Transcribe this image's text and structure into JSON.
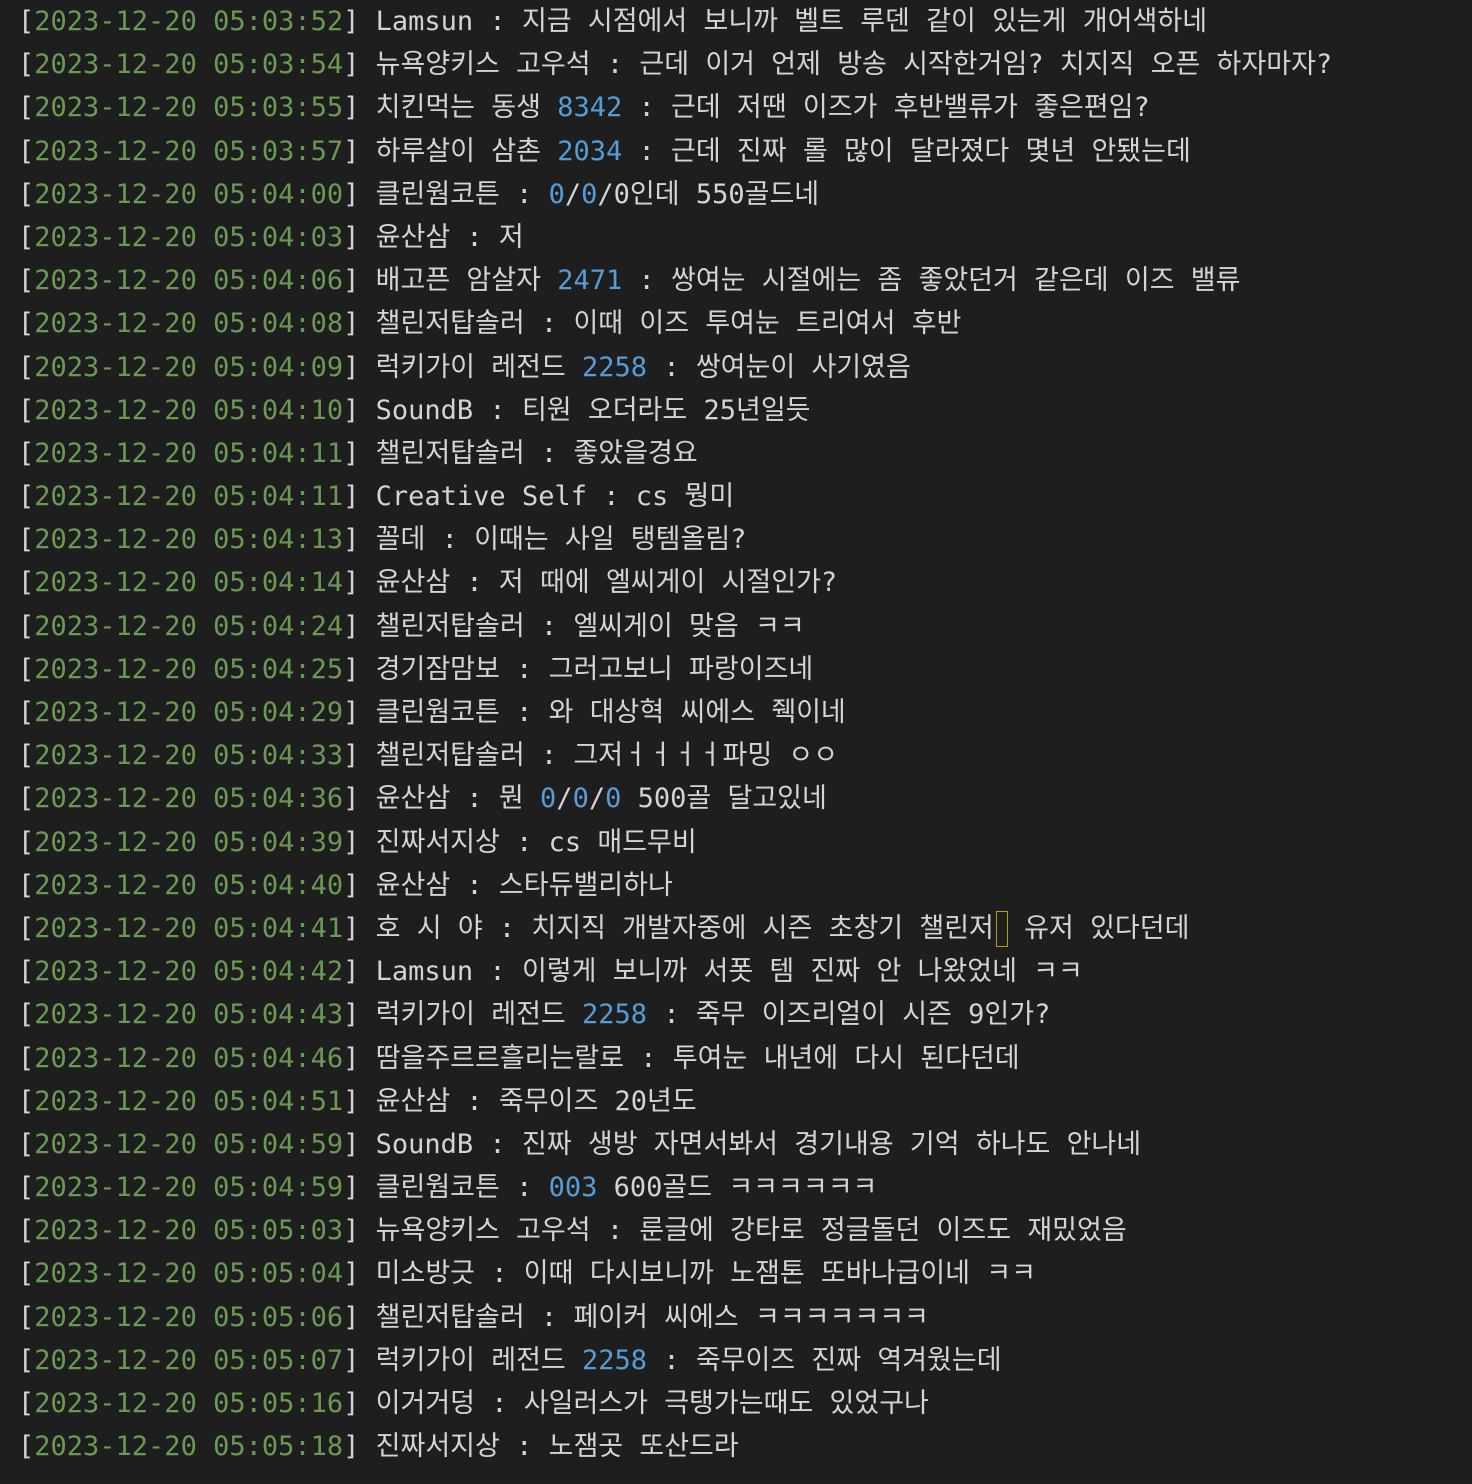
{
  "colors": {
    "background": "#1e1e1e",
    "text": "#d4d4d4",
    "timestamp": "#6a9955",
    "number": "#569cd6",
    "cursor_border": "#b5a000"
  },
  "lines": [
    {
      "ts": "2023-12-20 05:03:52",
      "segs": [
        {
          "t": "Lamsun : 지금 시점에서 보니까 벨트 루덴 같이 있는게 개어색하네"
        }
      ]
    },
    {
      "ts": "2023-12-20 05:03:54",
      "segs": [
        {
          "t": "뉴욕양키스 고우석 : 근데 이거 언제 방송 시작한거임? 치지직 오픈 하자마자?"
        }
      ]
    },
    {
      "ts": "2023-12-20 05:03:55",
      "segs": [
        {
          "t": "치킨먹는 동생 "
        },
        {
          "t": "8342",
          "c": "num"
        },
        {
          "t": " : 근데 저땐 이즈가 후반밸류가 좋은편임?"
        }
      ]
    },
    {
      "ts": "2023-12-20 05:03:57",
      "segs": [
        {
          "t": "하루살이 삼촌 "
        },
        {
          "t": "2034",
          "c": "num"
        },
        {
          "t": " : 근데 진짜 롤 많이 달라졌다 몇년 안됐는데"
        }
      ]
    },
    {
      "ts": "2023-12-20 05:04:00",
      "segs": [
        {
          "t": "클린웜코튼 : "
        },
        {
          "t": "0",
          "c": "num"
        },
        {
          "t": "/"
        },
        {
          "t": "0",
          "c": "num"
        },
        {
          "t": "/0인데 550골드네"
        }
      ]
    },
    {
      "ts": "2023-12-20 05:04:03",
      "segs": [
        {
          "t": "윤산삼 : 저"
        }
      ]
    },
    {
      "ts": "2023-12-20 05:04:06",
      "segs": [
        {
          "t": "배고픈 암살자 "
        },
        {
          "t": "2471",
          "c": "num"
        },
        {
          "t": " : 쌍여눈 시절에는 좀 좋았던거 같은데 이즈 밸류"
        }
      ]
    },
    {
      "ts": "2023-12-20 05:04:08",
      "segs": [
        {
          "t": "챌린저탑솔러 : 이때 이즈 투여눈 트리여서 후반"
        }
      ]
    },
    {
      "ts": "2023-12-20 05:04:09",
      "segs": [
        {
          "t": "럭키가이 레전드 "
        },
        {
          "t": "2258",
          "c": "num"
        },
        {
          "t": " : 쌍여눈이 사기였음"
        }
      ]
    },
    {
      "ts": "2023-12-20 05:04:10",
      "segs": [
        {
          "t": "SoundB : 티원 오더라도 25년일듯"
        }
      ]
    },
    {
      "ts": "2023-12-20 05:04:11",
      "segs": [
        {
          "t": "챌린저탑솔러 : 좋았을경요"
        }
      ]
    },
    {
      "ts": "2023-12-20 05:04:11",
      "segs": [
        {
          "t": "Creative Self : cs 뭥미"
        }
      ]
    },
    {
      "ts": "2023-12-20 05:04:13",
      "segs": [
        {
          "t": "꼴데 : 이때는 사일 탱템올림?"
        }
      ]
    },
    {
      "ts": "2023-12-20 05:04:14",
      "segs": [
        {
          "t": "윤산삼 : 저 때에 엘씨게이 시절인가?"
        }
      ]
    },
    {
      "ts": "2023-12-20 05:04:24",
      "segs": [
        {
          "t": "챌린저탑솔러 : 엘씨게이 맞음 ㅋㅋ"
        }
      ]
    },
    {
      "ts": "2023-12-20 05:04:25",
      "segs": [
        {
          "t": "경기잠맘보 : 그러고보니 파랑이즈네"
        }
      ]
    },
    {
      "ts": "2023-12-20 05:04:29",
      "segs": [
        {
          "t": "클린웜코튼 : 와 대상혁 씨에스 줵이네"
        }
      ]
    },
    {
      "ts": "2023-12-20 05:04:33",
      "segs": [
        {
          "t": "챌린저탑솔러 : 그저ㅓㅓㅓㅓ파밍 ㅇㅇ"
        }
      ]
    },
    {
      "ts": "2023-12-20 05:04:36",
      "segs": [
        {
          "t": "윤산삼 : 뭔 "
        },
        {
          "t": "0",
          "c": "num"
        },
        {
          "t": "/"
        },
        {
          "t": "0",
          "c": "num"
        },
        {
          "t": "/"
        },
        {
          "t": "0",
          "c": "num"
        },
        {
          "t": " 500골 달고있네"
        }
      ]
    },
    {
      "ts": "2023-12-20 05:04:39",
      "segs": [
        {
          "t": "진짜서지상 : cs 매드무비"
        }
      ]
    },
    {
      "ts": "2023-12-20 05:04:40",
      "segs": [
        {
          "t": "윤산삼 : 스타듀밸리하나"
        }
      ]
    },
    {
      "ts": "2023-12-20 05:04:41",
      "segs": [
        {
          "t": "호 시 야 : 치지직 개발자중에 시즌 초창기 챌린저"
        },
        {
          "t": "",
          "c": "cursor"
        },
        {
          "t": " 유저 있다던데"
        }
      ]
    },
    {
      "ts": "2023-12-20 05:04:42",
      "segs": [
        {
          "t": "Lamsun : 이렇게 보니까 서폿 템 진짜 안 나왔었네 ㅋㅋ"
        }
      ]
    },
    {
      "ts": "2023-12-20 05:04:43",
      "segs": [
        {
          "t": "럭키가이 레전드 "
        },
        {
          "t": "2258",
          "c": "num"
        },
        {
          "t": " : 죽무 이즈리얼이 시즌 9인가?"
        }
      ]
    },
    {
      "ts": "2023-12-20 05:04:46",
      "segs": [
        {
          "t": "땀을주르르흘리는랄로 : 투여눈 내년에 다시 된다던데"
        }
      ]
    },
    {
      "ts": "2023-12-20 05:04:51",
      "segs": [
        {
          "t": "윤산삼 : 죽무이즈 20년도"
        }
      ]
    },
    {
      "ts": "2023-12-20 05:04:59",
      "segs": [
        {
          "t": "SoundB : 진짜 생방 자면서봐서 경기내용 기억 하나도 안나네"
        }
      ]
    },
    {
      "ts": "2023-12-20 05:04:59",
      "segs": [
        {
          "t": "클린웜코튼 : "
        },
        {
          "t": "003",
          "c": "num"
        },
        {
          "t": " 600골드 ㅋㅋㅋㅋㅋㅋ"
        }
      ]
    },
    {
      "ts": "2023-12-20 05:05:03",
      "segs": [
        {
          "t": "뉴욕양키스 고우석 : 룬글에 강타로 정글돌던 이즈도 재밌었음"
        }
      ]
    },
    {
      "ts": "2023-12-20 05:05:04",
      "segs": [
        {
          "t": "미소방긋 : 이때 다시보니까 노잼톤 또바나급이네 ㅋㅋ"
        }
      ]
    },
    {
      "ts": "2023-12-20 05:05:06",
      "segs": [
        {
          "t": "챌린저탑솔러 : 페이커 씨에스 ㅋㅋㅋㅋㅋㅋㅋ"
        }
      ]
    },
    {
      "ts": "2023-12-20 05:05:07",
      "segs": [
        {
          "t": "럭키가이 레전드 "
        },
        {
          "t": "2258",
          "c": "num"
        },
        {
          "t": " : 죽무이즈 진짜 역겨웠는데"
        }
      ]
    },
    {
      "ts": "2023-12-20 05:05:16",
      "segs": [
        {
          "t": "이거거덩 : 사일러스가 극탱가는때도 있었구나"
        }
      ]
    },
    {
      "ts": "2023-12-20 05:05:18",
      "segs": [
        {
          "t": "진짜서지상 : 노잼곳 또산드라"
        }
      ]
    }
  ]
}
